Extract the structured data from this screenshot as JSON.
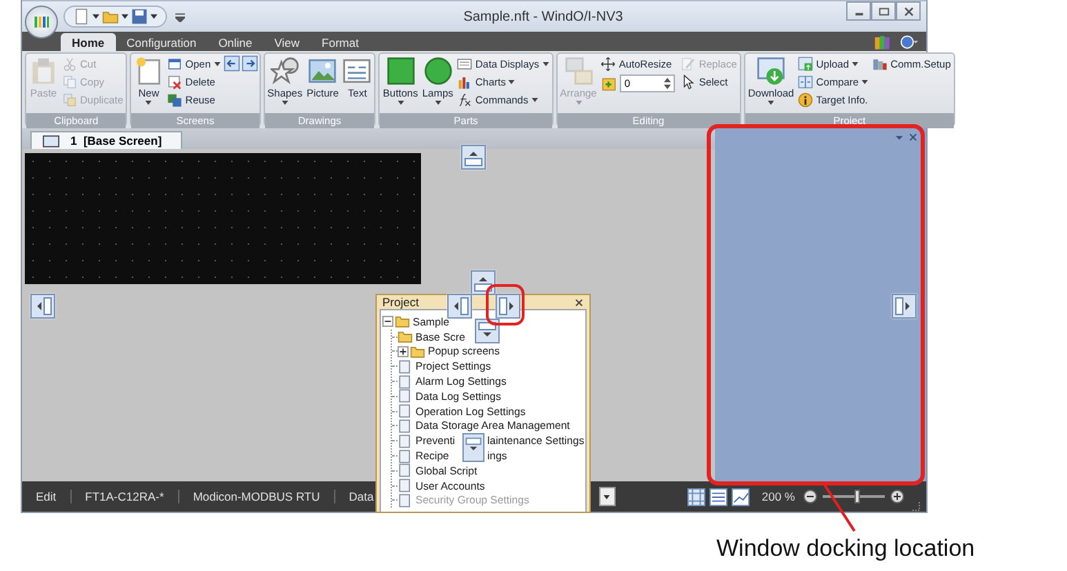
{
  "window": {
    "title": "Sample.nft - WindO/I-NV3"
  },
  "ribbon_tabs": [
    {
      "label": "Home",
      "selected": true
    },
    {
      "label": "Configuration",
      "selected": false
    },
    {
      "label": "Online",
      "selected": false
    },
    {
      "label": "View",
      "selected": false
    },
    {
      "label": "Format",
      "selected": false
    }
  ],
  "ribbon_groups": [
    {
      "label": "Clipboard",
      "columns": [
        [
          {
            "kind": "large",
            "label": "Paste",
            "disabled": true,
            "dropdown": false
          }
        ],
        [
          {
            "kind": "small",
            "label": "Cut",
            "disabled": true,
            "dropdown": false
          },
          {
            "kind": "small",
            "label": "Copy",
            "disabled": true,
            "dropdown": false
          },
          {
            "kind": "small",
            "label": "Duplicate",
            "disabled": true,
            "dropdown": false
          }
        ]
      ]
    },
    {
      "label": "Screens",
      "columns": [
        [
          {
            "kind": "large",
            "label": "New",
            "disabled": false,
            "dropdown": true
          }
        ],
        [
          {
            "kind": "small",
            "label": "Open",
            "disabled": false,
            "dropdown": true
          },
          {
            "kind": "small",
            "label": "Delete",
            "disabled": false,
            "dropdown": false
          },
          {
            "kind": "small",
            "label": "Reuse",
            "disabled": false,
            "dropdown": false
          }
        ],
        [
          {
            "kind": "icon_button",
            "disabled": false
          }
        ],
        [
          {
            "kind": "icon_button",
            "disabled": false
          }
        ]
      ]
    },
    {
      "label": "Drawings",
      "columns": [
        [
          {
            "kind": "large",
            "label": "Shapes",
            "disabled": false,
            "dropdown": true
          }
        ],
        [
          {
            "kind": "large",
            "label": "Picture",
            "disabled": false,
            "dropdown": false
          }
        ],
        [
          {
            "kind": "large",
            "label": "Text",
            "disabled": false,
            "dropdown": false
          }
        ]
      ]
    },
    {
      "label": "Parts",
      "columns": [
        [
          {
            "kind": "large",
            "label": "Buttons",
            "disabled": false,
            "dropdown": true
          }
        ],
        [
          {
            "kind": "large",
            "label": "Lamps",
            "disabled": false,
            "dropdown": true
          }
        ],
        [
          {
            "kind": "small",
            "label": "Data Displays",
            "disabled": false,
            "dropdown": true
          },
          {
            "kind": "small",
            "label": "Charts",
            "disabled": false,
            "dropdown": true
          },
          {
            "kind": "small",
            "label": "Commands",
            "disabled": false,
            "dropdown": true
          }
        ]
      ]
    },
    {
      "label": "Editing",
      "columns": [
        [
          {
            "kind": "large",
            "label": "Arrange",
            "disabled": true,
            "dropdown": true
          }
        ],
        [
          {
            "kind": "small",
            "label": "AutoResize",
            "disabled": false,
            "dropdown": false
          },
          {
            "kind": "spin",
            "value": "0"
          }
        ],
        [
          {
            "kind": "small",
            "label": "Replace",
            "disabled": true,
            "dropdown": false
          },
          {
            "kind": "small",
            "label": "Select",
            "disabled": false,
            "dropdown": false
          }
        ]
      ]
    },
    {
      "label": "Project",
      "columns": [
        [
          {
            "kind": "large",
            "label": "Download",
            "disabled": false,
            "dropdown": true
          }
        ],
        [
          {
            "kind": "small",
            "label": "Upload",
            "disabled": false,
            "dropdown": true
          },
          {
            "kind": "small",
            "label": "Compare",
            "disabled": false,
            "dropdown": true
          },
          {
            "kind": "small",
            "label": "Target Info.",
            "disabled": false,
            "dropdown": false
          }
        ],
        [
          {
            "kind": "small",
            "label": "Comm.Setup",
            "disabled": false,
            "dropdown": false
          }
        ]
      ]
    }
  ],
  "doc_tabs": [
    {
      "label": "1  [Base Screen]",
      "selected": true
    }
  ],
  "project_panel": {
    "title": "Project",
    "tree": [
      {
        "label": "Sample",
        "kind": "folder",
        "expanded": true,
        "disabled": false,
        "children": [
          {
            "label": "Base Scre",
            "kind": "folder",
            "disabled": false
          },
          {
            "label": "Popup screens",
            "kind": "folder",
            "expanded": false,
            "disabled": false
          },
          {
            "label": "Project Settings",
            "kind": "doc",
            "disabled": false
          },
          {
            "label": "Alarm Log Settings",
            "kind": "doc",
            "disabled": false
          },
          {
            "label": "Data Log Settings",
            "kind": "doc",
            "disabled": false
          },
          {
            "label": "Operation Log Settings",
            "kind": "doc",
            "disabled": false
          },
          {
            "label": "Data Storage Area Management",
            "kind": "doc",
            "disabled": false
          },
          {
            "label": "Preventi",
            "label_after": "laintenance Settings",
            "kind": "doc",
            "disabled": false
          },
          {
            "label": "Recipe",
            "label_after": "ings",
            "kind": "doc",
            "disabled": false
          },
          {
            "label": "Global Script",
            "kind": "doc",
            "disabled": false
          },
          {
            "label": "User Accounts",
            "kind": "doc",
            "disabled": false
          },
          {
            "label": "Security Group Settings",
            "kind": "doc",
            "disabled": true
          }
        ]
      }
    ]
  },
  "status_bar": {
    "items": [
      "Edit",
      "FT1A-C12RA-*",
      "Modicon-MODBUS RTU",
      "Data"
    ],
    "zoom": "200 %",
    "zoom_slider": {
      "level": 0.55
    }
  },
  "callout": "Window docking location"
}
